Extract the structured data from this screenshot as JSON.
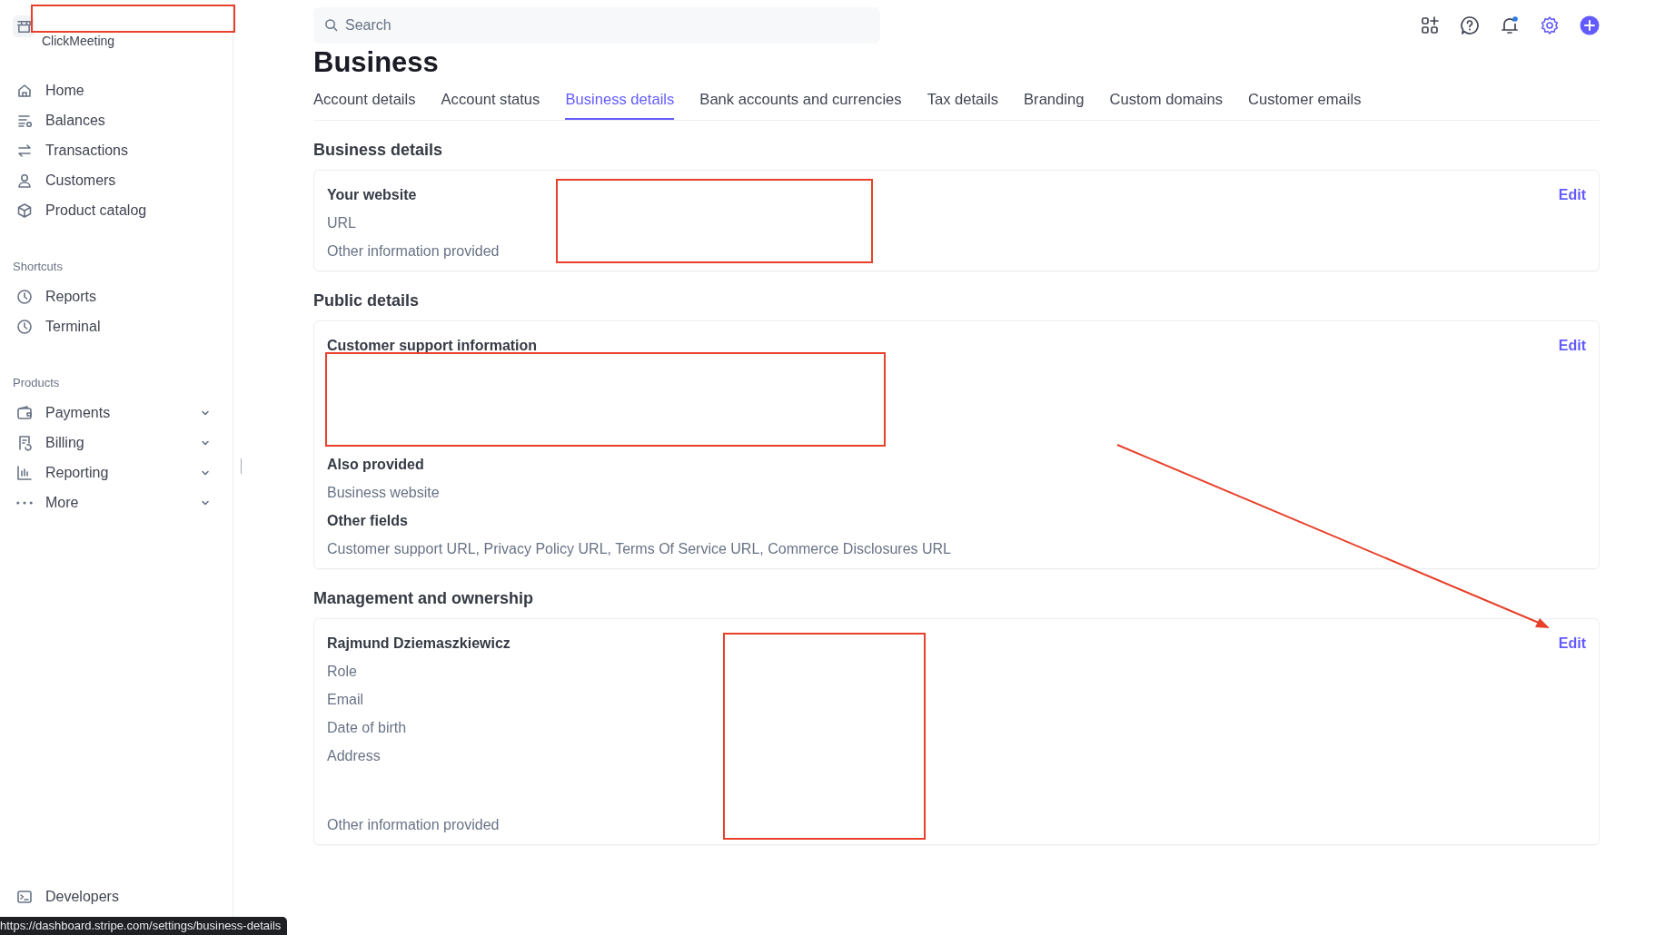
{
  "account": {
    "name": "ClickMeeting"
  },
  "search": {
    "placeholder": "Search"
  },
  "sidebar": {
    "items": [
      {
        "label": "Home"
      },
      {
        "label": "Balances"
      },
      {
        "label": "Transactions"
      },
      {
        "label": "Customers"
      },
      {
        "label": "Product catalog"
      }
    ],
    "sections": [
      {
        "title": "Shortcuts",
        "items": [
          {
            "label": "Reports",
            "expandable": false
          },
          {
            "label": "Terminal",
            "expandable": false
          }
        ]
      },
      {
        "title": "Products",
        "items": [
          {
            "label": "Payments",
            "expandable": true
          },
          {
            "label": "Billing",
            "expandable": true
          },
          {
            "label": "Reporting",
            "expandable": true
          },
          {
            "label": "More",
            "expandable": true
          }
        ]
      }
    ],
    "footer": {
      "label": "Developers"
    }
  },
  "page": {
    "title": "Business"
  },
  "tabs": [
    {
      "label": "Account details",
      "selected": false
    },
    {
      "label": "Account status",
      "selected": false
    },
    {
      "label": "Business details",
      "selected": true
    },
    {
      "label": "Bank accounts and currencies",
      "selected": false
    },
    {
      "label": "Tax details",
      "selected": false
    },
    {
      "label": "Branding",
      "selected": false
    },
    {
      "label": "Custom domains",
      "selected": false
    },
    {
      "label": "Customer emails",
      "selected": false
    }
  ],
  "sections": [
    {
      "title": "Business details",
      "edit": "Edit",
      "rows": [
        {
          "kind": "heading",
          "text": "Your website"
        },
        {
          "kind": "label",
          "text": "URL"
        },
        {
          "kind": "label",
          "text": "Other information provided"
        }
      ]
    },
    {
      "title": "Public details",
      "edit": "Edit",
      "rows": [
        {
          "kind": "heading",
          "text": "Customer support information"
        },
        {
          "kind": "blank"
        },
        {
          "kind": "heading",
          "text": "Also provided"
        },
        {
          "kind": "label",
          "text": "Business website"
        },
        {
          "kind": "heading",
          "text": "Other fields"
        },
        {
          "kind": "label",
          "text": "Customer support URL, Privacy Policy URL, Terms Of Service URL, Commerce Disclosures URL"
        }
      ]
    },
    {
      "title": "Management and ownership",
      "edit": "Edit",
      "rows": [
        {
          "kind": "heading",
          "text": "Rajmund Dziemaszkiewicz"
        },
        {
          "kind": "label",
          "text": "Role"
        },
        {
          "kind": "label",
          "text": "Email"
        },
        {
          "kind": "label",
          "text": "Date of birth"
        },
        {
          "kind": "label",
          "text": "Address"
        },
        {
          "kind": "spacer"
        },
        {
          "kind": "label",
          "text": "Other information provided"
        }
      ]
    }
  ],
  "status_bar": {
    "url": "https://dashboard.stripe.com/settings/business-details"
  }
}
